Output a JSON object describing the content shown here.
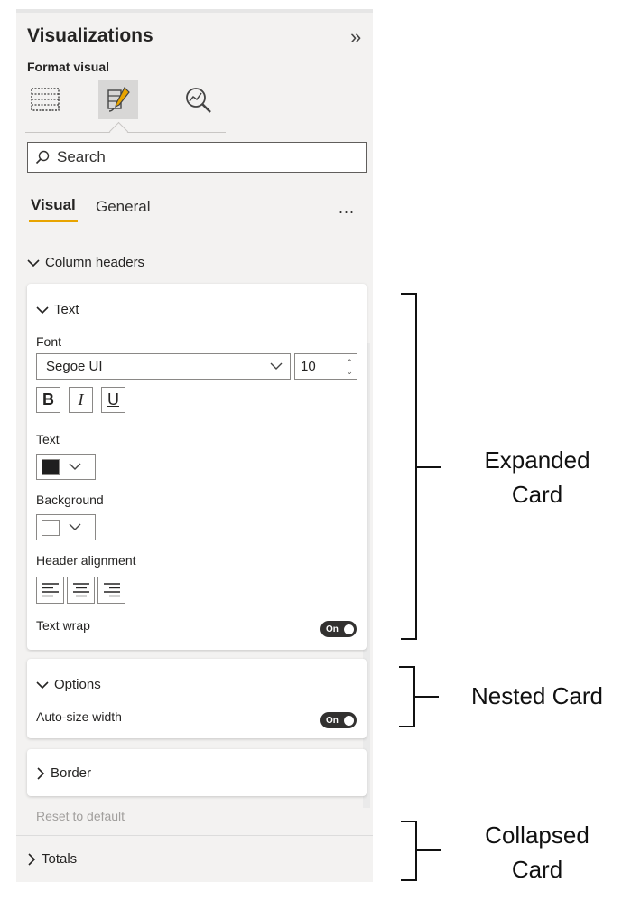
{
  "pane": {
    "title": "Visualizations",
    "subtitle": "Format visual",
    "tabs_icons": [
      "build-visual-icon",
      "format-paintbrush-icon",
      "analytics-magnifier-icon"
    ]
  },
  "search": {
    "placeholder": "Search"
  },
  "subtabs": {
    "visual": "Visual",
    "general": "General",
    "more": "..."
  },
  "section": {
    "title": "Column headers",
    "text_card": {
      "title": "Text",
      "font_label": "Font",
      "font_value": "Segoe UI",
      "size_value": "10",
      "bold": "B",
      "italic": "I",
      "underline": "U",
      "text_label": "Text",
      "text_color": "#1f1f1f",
      "background_label": "Background",
      "background_color": "#ffffff",
      "alignment_label": "Header alignment",
      "wrap_label": "Text wrap",
      "wrap_state": "On"
    },
    "options_card": {
      "title": "Options",
      "autosize_label": "Auto-size width",
      "autosize_state": "On"
    },
    "border_card": {
      "title": "Border"
    },
    "reset": "Reset to default"
  },
  "totals": {
    "title": "Totals"
  },
  "annotations": {
    "expanded": [
      "Expanded",
      "Card"
    ],
    "nested": [
      "Nested Card"
    ],
    "collapsed": [
      "Collapsed",
      "Card"
    ]
  },
  "colors": {
    "accent": "#e8a400",
    "pane_bg": "#f3f2f1",
    "toggle_on": "#323130"
  }
}
